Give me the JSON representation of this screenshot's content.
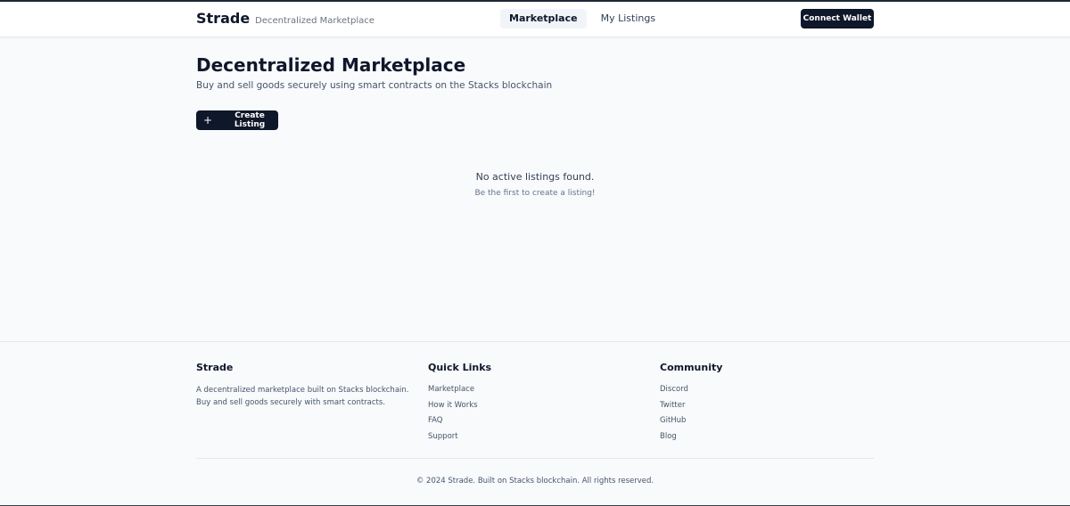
{
  "header": {
    "brand": "Strade",
    "tagline": "Decentralized Marketplace",
    "nav": [
      {
        "label": "Marketplace",
        "active": true
      },
      {
        "label": "My Listings",
        "active": false
      }
    ],
    "connect_label": "Connect Wallet"
  },
  "main": {
    "title": "Decentralized Marketplace",
    "subtitle": "Buy and sell goods securely using smart contracts on the Stacks blockchain",
    "create_label": "Create Listing",
    "create_icon": "plus-icon",
    "empty_title": "No active listings found.",
    "empty_sub": "Be the first to create a listing!"
  },
  "footer": {
    "brand": "Strade",
    "description": "A decentralized marketplace built on Stacks blockchain. Buy and sell goods securely with smart contracts.",
    "quick_links": {
      "title": "Quick Links",
      "items": [
        "Marketplace",
        "How it Works",
        "FAQ",
        "Support"
      ]
    },
    "community": {
      "title": "Community",
      "items": [
        "Discord",
        "Twitter",
        "GitHub",
        "Blog"
      ]
    },
    "copyright": "© 2024 Strade. Built on Stacks blockchain. All rights reserved."
  },
  "colors": {
    "primary": "#0f172a",
    "background": "#f8fafc",
    "muted_text": "#475569"
  }
}
